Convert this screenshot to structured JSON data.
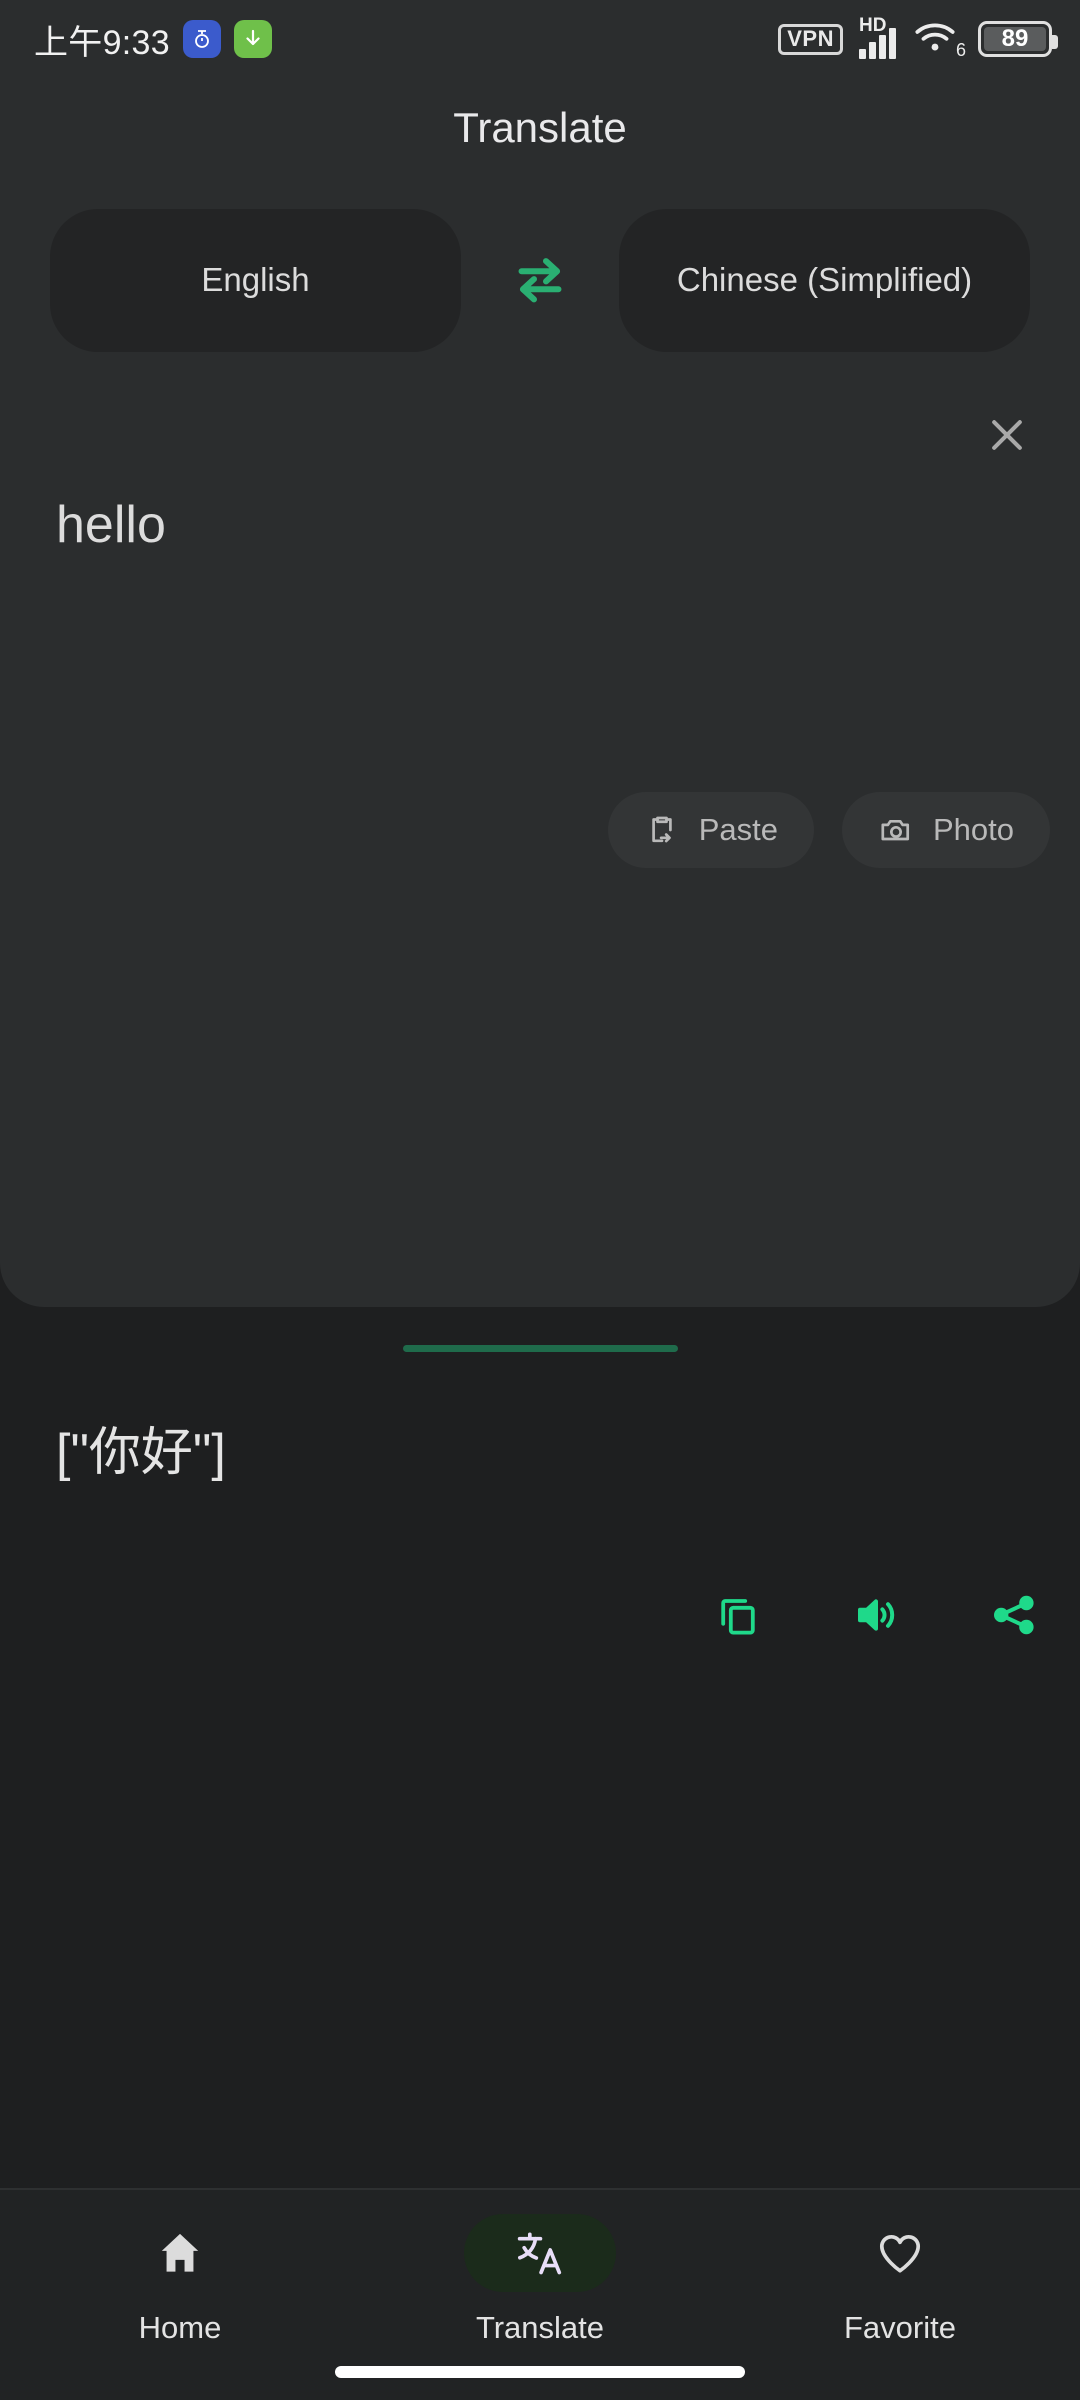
{
  "status_bar": {
    "clock": "上午9:33",
    "badges": [
      {
        "name": "notification-badge-blue",
        "glyph": "⏱"
      },
      {
        "name": "download-badge-green",
        "glyph": "↓"
      }
    ],
    "vpn_label": "VPN",
    "network_type": "HD",
    "wifi_generation": "6",
    "battery_percent": "89"
  },
  "header": {
    "title": "Translate"
  },
  "language_selector": {
    "source_language": "English",
    "target_language": "Chinese (Simplified)",
    "swap_icon": "swap-horizontal-arrows-icon",
    "accent_color": "#2aaf72"
  },
  "translate_card": {
    "clear_icon": "close-icon",
    "source_text": "hello",
    "quick_actions": [
      {
        "name": "paste-button",
        "label": "Paste",
        "icon": "clipboard-paste-icon"
      },
      {
        "name": "photo-button",
        "label": "Photo",
        "icon": "camera-icon"
      }
    ],
    "divider_color": "#1f6b4b",
    "translated_text": "[\"你好\"]",
    "result_actions": [
      {
        "name": "copy-button",
        "icon": "copy-icon"
      },
      {
        "name": "listen-button",
        "icon": "speaker-volume-icon"
      },
      {
        "name": "share-button",
        "icon": "share-icon"
      }
    ],
    "action_color": "#1fd98a"
  },
  "bottom_nav": {
    "items": [
      {
        "name": "nav-home",
        "label": "Home",
        "icon": "home-icon",
        "active": false
      },
      {
        "name": "nav-translate",
        "label": "Translate",
        "icon": "translate-icon",
        "active": true
      },
      {
        "name": "nav-favorite",
        "label": "Favorite",
        "icon": "heart-icon",
        "active": false
      }
    ],
    "active_pill_color": "#1b2b1b",
    "active_icon_color": "#e8def8"
  }
}
